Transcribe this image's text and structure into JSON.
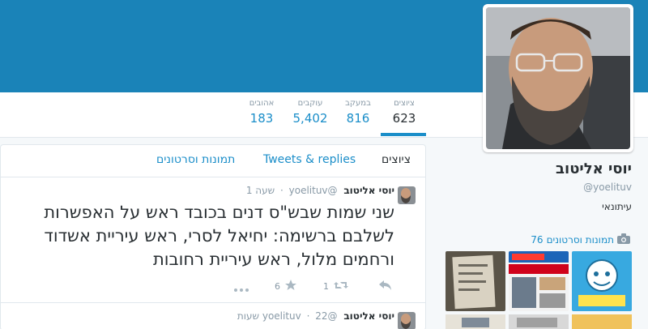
{
  "profile": {
    "name": "יוסי אליטוב",
    "handle": "@yoelituv",
    "bio": "עיתונאי"
  },
  "stats": [
    {
      "label": "ציוצים",
      "value": "623",
      "active": true
    },
    {
      "label": "במעקב",
      "value": "816",
      "active": false
    },
    {
      "label": "עוקבים",
      "value": "5,402",
      "active": false
    },
    {
      "label": "אהובים",
      "value": "183",
      "active": false
    }
  ],
  "tabs": [
    {
      "label": "ציוצים",
      "active": true
    },
    {
      "label": "Tweets & replies",
      "active": false
    },
    {
      "label": "תמונות וסרטונים",
      "active": false
    }
  ],
  "photos": {
    "count": "76",
    "label": "תמונות וסרטונים"
  },
  "tweets": [
    {
      "author": "יוסי אליטוב",
      "handle": "@yoelituv",
      "time": "שעה 1",
      "text": "שני שמות שבש\"ס דנים בכובד ראש על האפשרות לשלבם ברשימה: יחיאל לסרי, ראש עיריית אשדוד ורחמים מלול, ראש עיריית רחובות",
      "retweets": "1",
      "favorites": "6"
    },
    {
      "author": "יוסי אליטוב",
      "handle": "@yoelituv",
      "time": "22 שעות"
    }
  ],
  "colors": {
    "banner": "#1a83b8",
    "accent": "#1b8ec9"
  }
}
